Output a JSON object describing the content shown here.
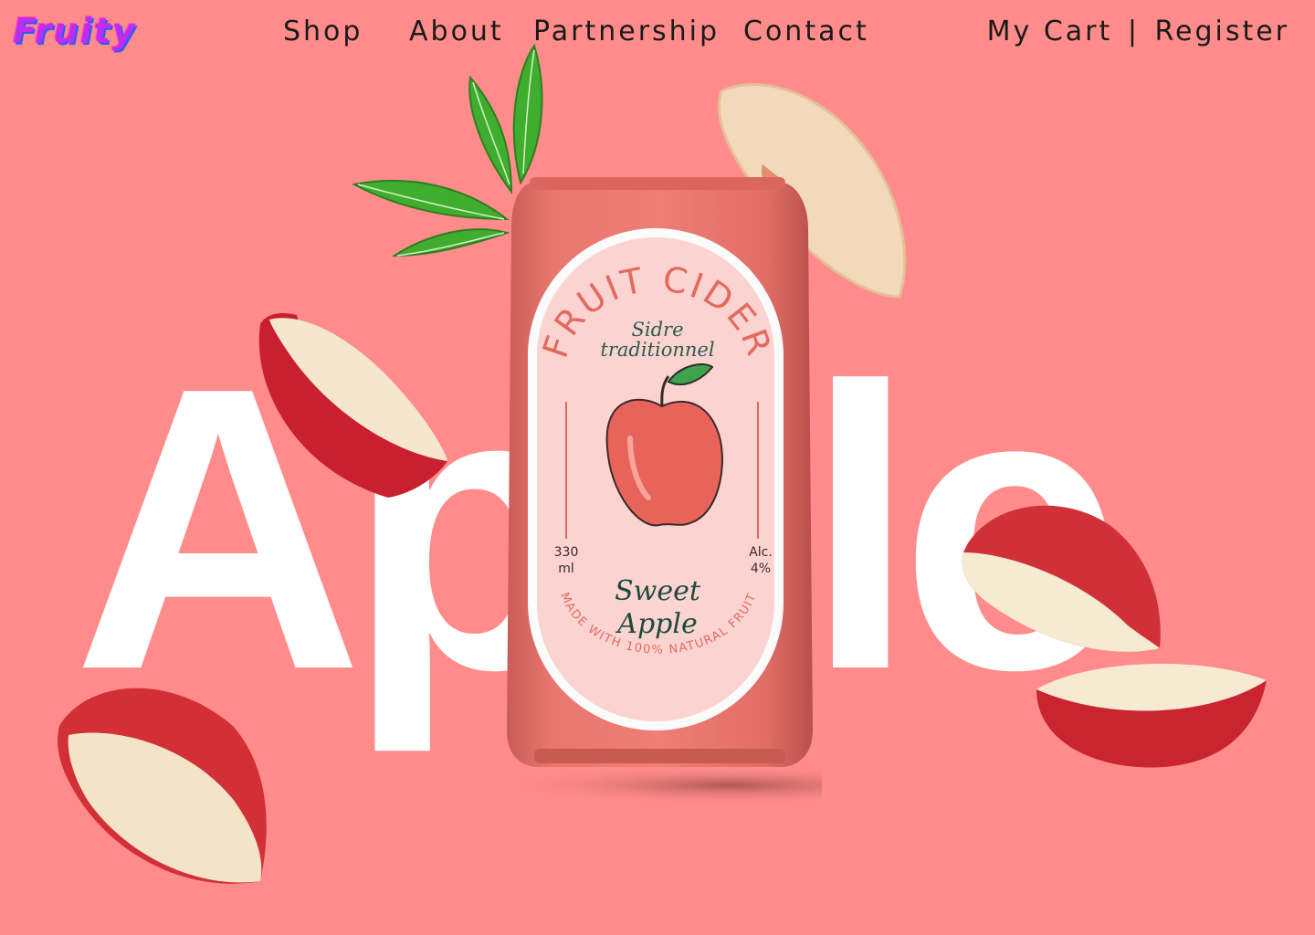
{
  "brand": {
    "name": "Fruity"
  },
  "nav": {
    "links": [
      "Shop",
      "About",
      "Partnership",
      "Contact"
    ],
    "cart": "My Cart",
    "separator": "|",
    "register": "Register"
  },
  "hero": {
    "word": "Apple"
  },
  "product": {
    "title": "FRUIT CIDER",
    "subtitle_line1": "Sidre",
    "subtitle_line2": "traditionnel",
    "volume_value": "330",
    "volume_unit": "ml",
    "alcohol_label": "Alc.",
    "alcohol_value": "4%",
    "flavor_line1": "Sweet",
    "flavor_line2": "Apple",
    "tagline": "MADE WITH 100% NATURAL FRUIT"
  },
  "colors": {
    "background": "#ff8c8a",
    "can": "#e8726c",
    "label": "#fbd4d2",
    "title": "#e36a5f"
  }
}
